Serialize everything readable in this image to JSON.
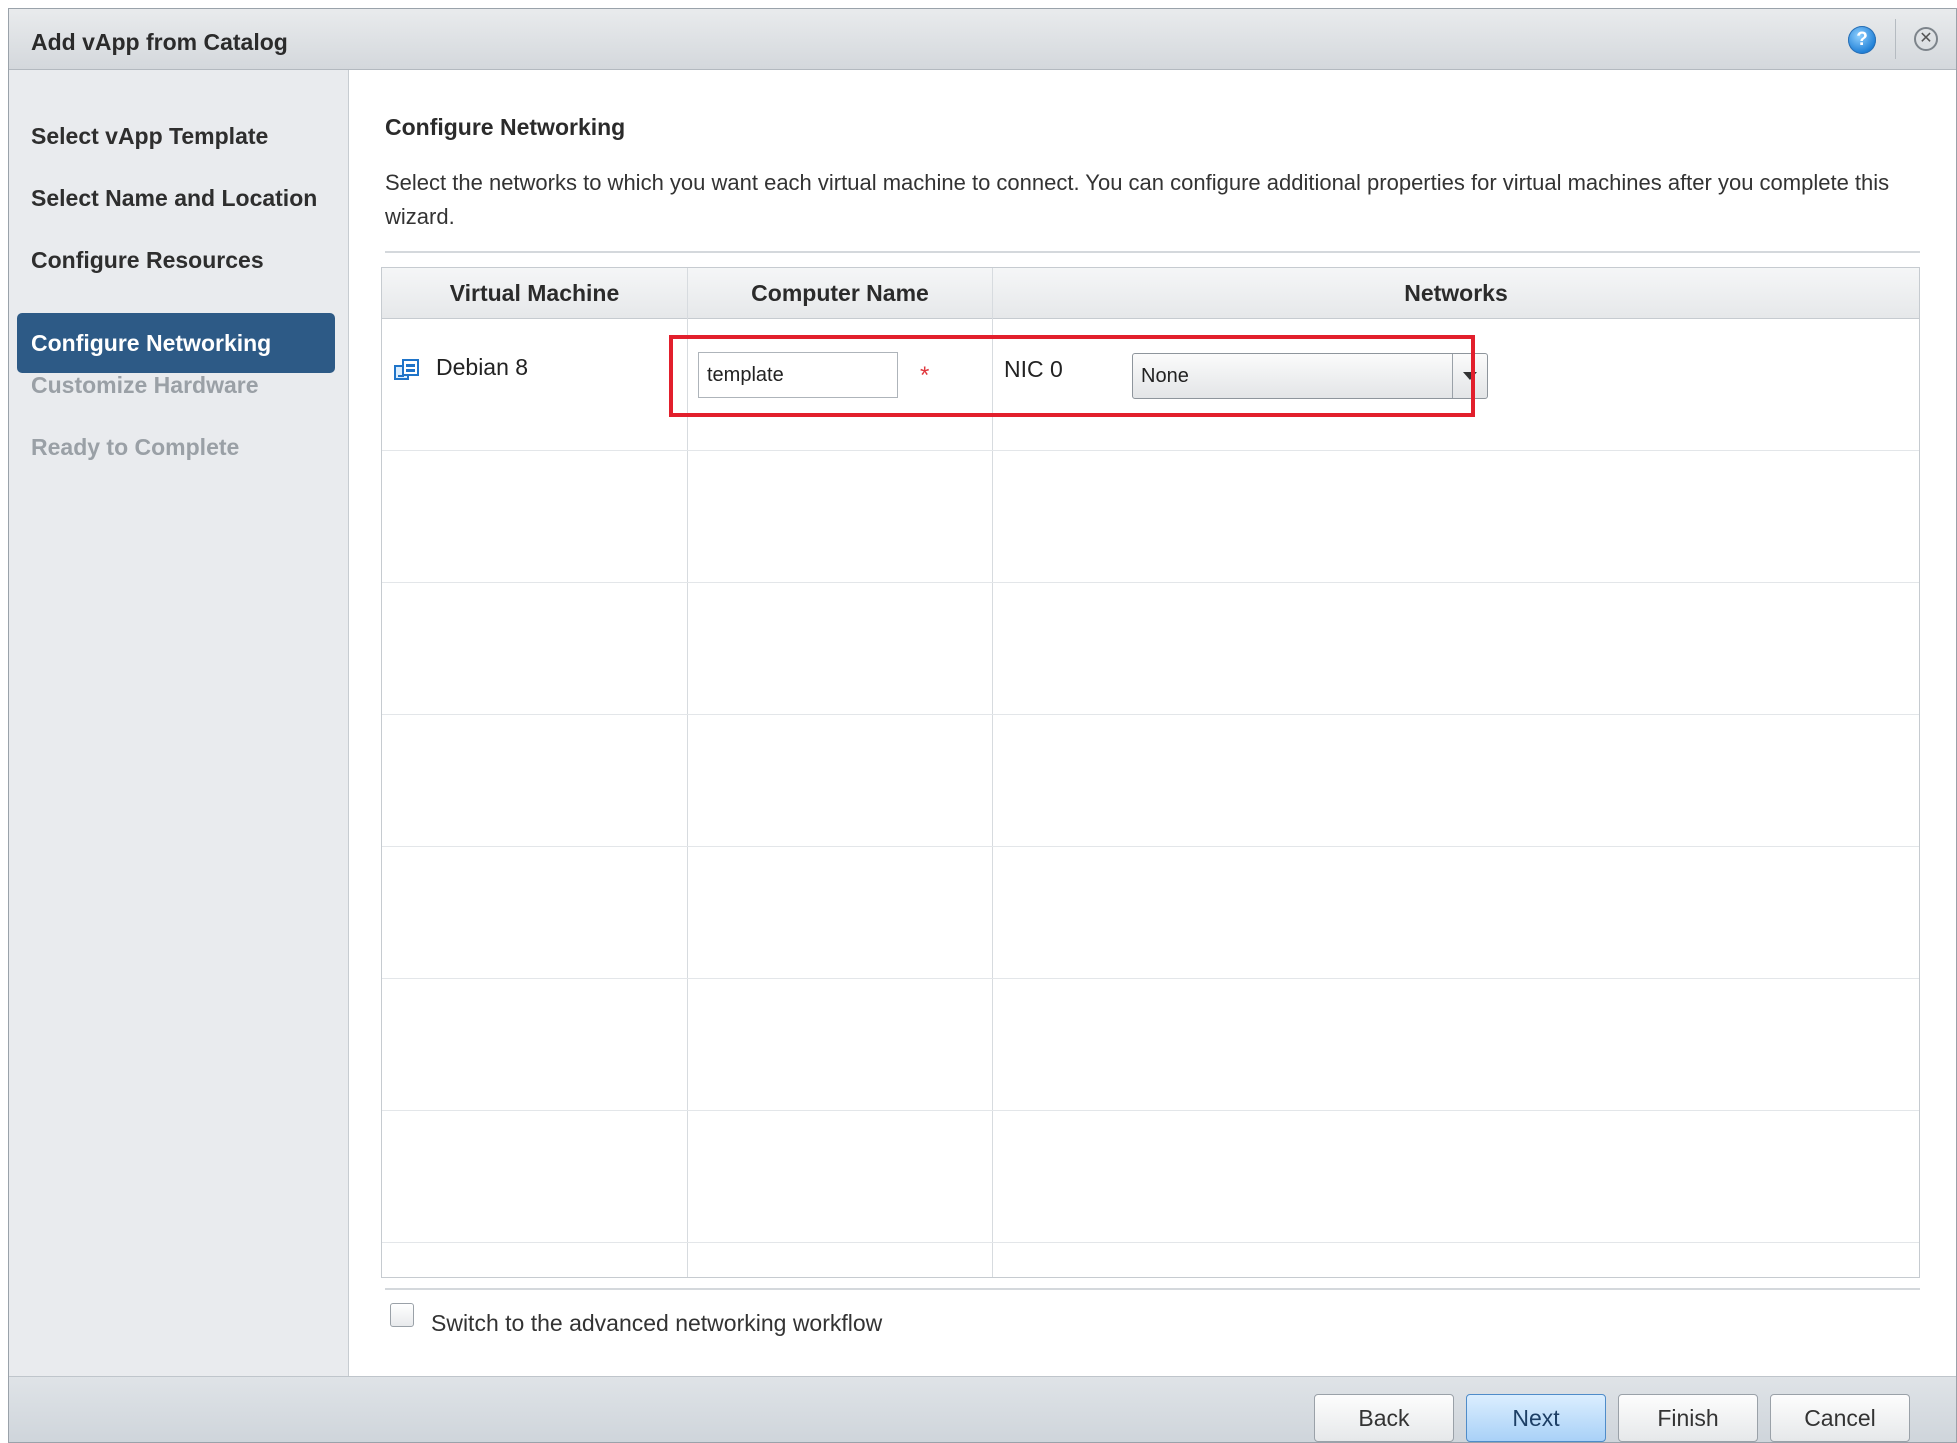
{
  "dialog": {
    "title": "Add vApp from Catalog",
    "help_icon": "question-circle-icon",
    "help_glyph": "?",
    "close_icon": "close-circle-icon",
    "close_glyph": "✕"
  },
  "wizard": {
    "steps": [
      {
        "label": "Select vApp Template",
        "state": "completed"
      },
      {
        "label": "Select Name and Location",
        "state": "completed"
      },
      {
        "label": "Configure Resources",
        "state": "completed"
      },
      {
        "label": "Configure Networking",
        "state": "active"
      },
      {
        "label": "Customize Hardware",
        "state": "disabled"
      },
      {
        "label": "Ready to Complete",
        "state": "disabled"
      }
    ]
  },
  "main": {
    "section_title": "Configure Networking",
    "description": "Select the networks to which you want each virtual machine to connect. You can configure additional properties for virtual machines after you complete this wizard.",
    "table": {
      "columns": [
        "Virtual Machine",
        "Computer Name",
        "Networks"
      ],
      "rows": [
        {
          "vm_icon": "virtual-machine-icon",
          "vm_name": "Debian 8",
          "computer_name": "template",
          "required_marker": "*",
          "nic_label": "NIC 0",
          "network_selected": "None"
        }
      ]
    },
    "advanced_checkbox": {
      "label": "Switch to the advanced networking workflow",
      "checked": false
    }
  },
  "footer": {
    "back": "Back",
    "next": "Next",
    "finish": "Finish",
    "cancel": "Cancel"
  },
  "colors": {
    "active_step": "#2d5a86",
    "highlight": "#e21f2c",
    "required": "#e0383e"
  }
}
